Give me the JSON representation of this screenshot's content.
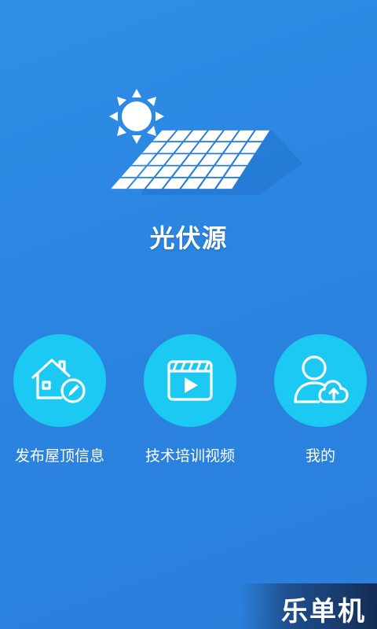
{
  "app": {
    "title": "光伏源"
  },
  "logo": {
    "icon": "solar-panel-sun-icon"
  },
  "menu": {
    "items": [
      {
        "label": "发布屋顶信息",
        "icon": "house-edit-icon"
      },
      {
        "label": "技术培训视频",
        "icon": "video-play-icon"
      },
      {
        "label": "我的",
        "icon": "user-cloud-icon"
      }
    ]
  },
  "watermark": {
    "text": "乐单机"
  },
  "colors": {
    "background": "#2f8fe6",
    "circle": "#1bc9f2",
    "text": "#ffffff"
  }
}
